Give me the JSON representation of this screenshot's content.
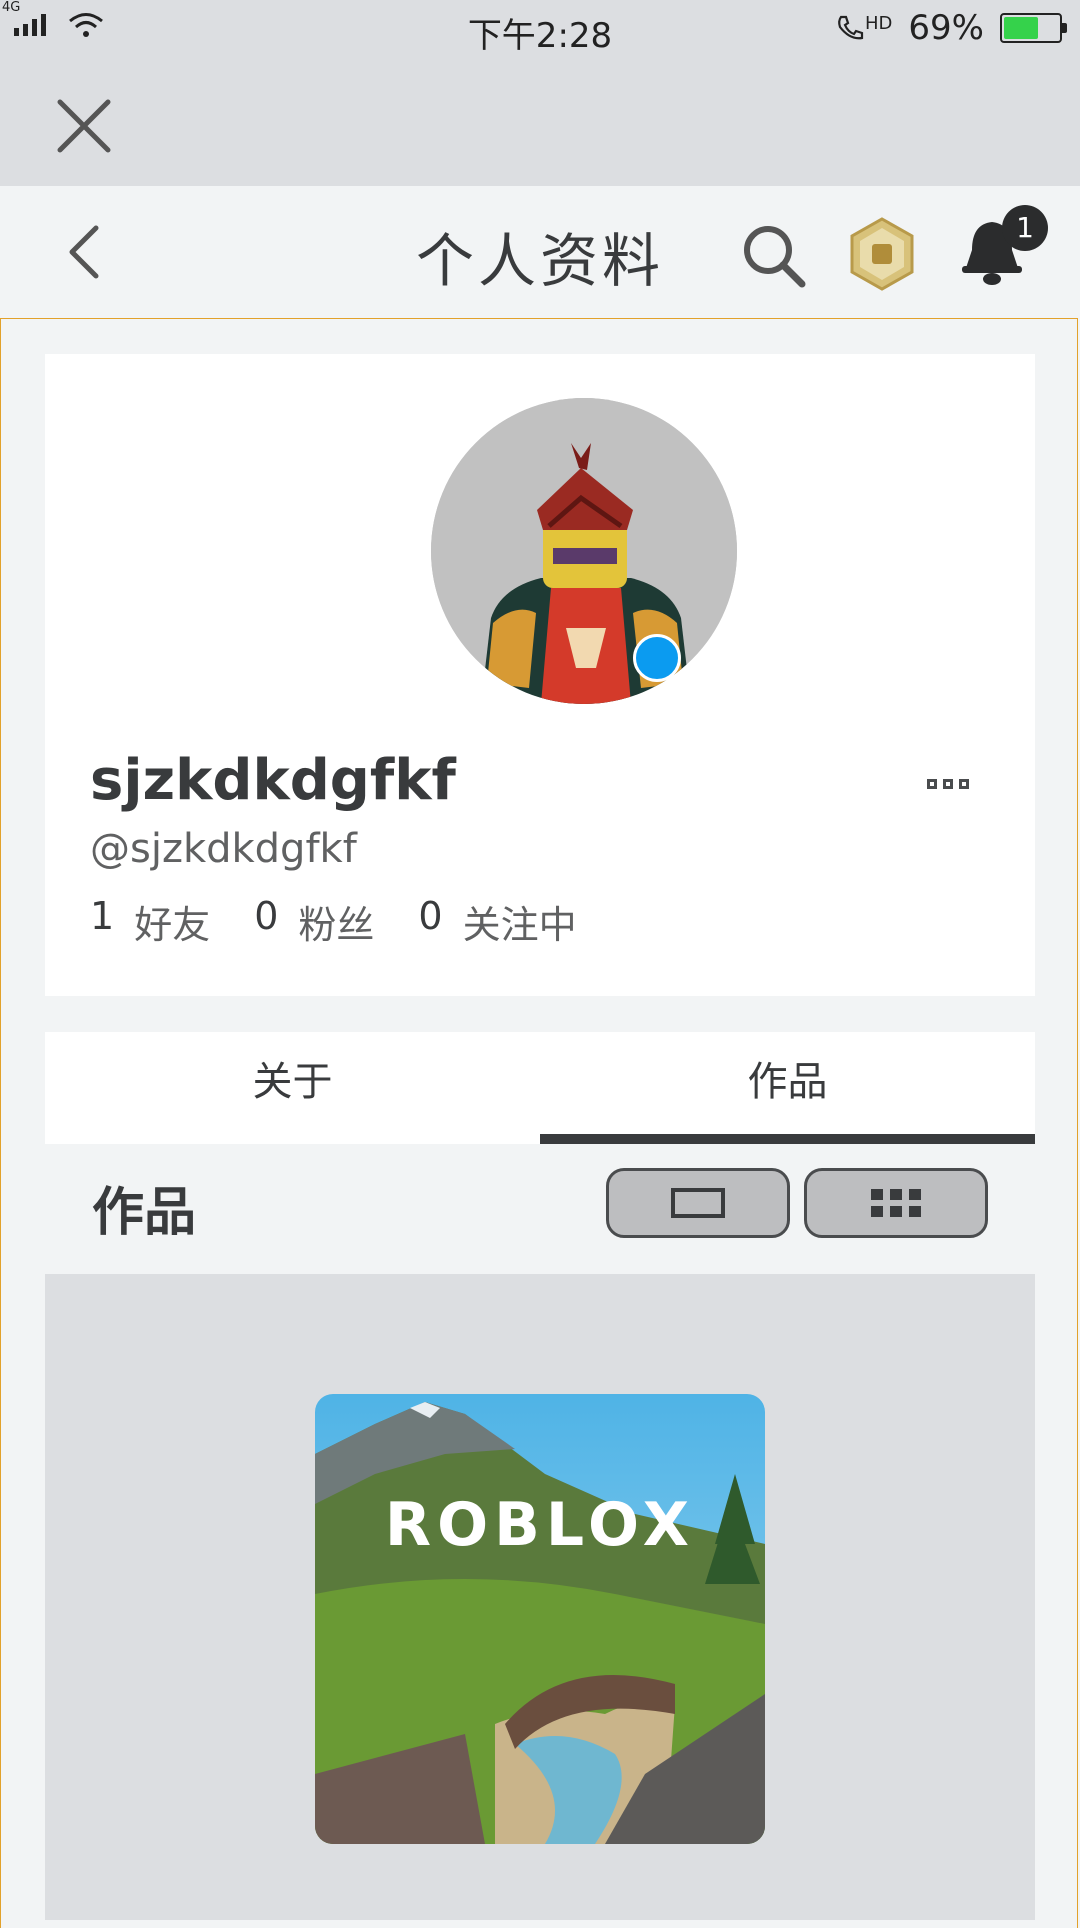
{
  "status_bar": {
    "network": "4G",
    "time": "下午2:28",
    "call_hd": "HD",
    "battery": "69%"
  },
  "header": {
    "title": "个人资料",
    "notification_count": "1"
  },
  "profile": {
    "display_name": "sjzkdkdgfkf",
    "username": "@sjzkdkdgfkf",
    "stats": [
      {
        "value": "1",
        "label": "好友"
      },
      {
        "value": "0",
        "label": "粉丝"
      },
      {
        "value": "0",
        "label": "关注中"
      }
    ]
  },
  "tabs": [
    {
      "label": "关于",
      "active": false
    },
    {
      "label": "作品",
      "active": true
    }
  ],
  "creations": {
    "title": "作品",
    "games": [
      {
        "logo_text": "ROBLOX"
      }
    ]
  },
  "colors": {
    "accent_presence": "#0b9bf0",
    "frame_border": "#e2a12b"
  }
}
